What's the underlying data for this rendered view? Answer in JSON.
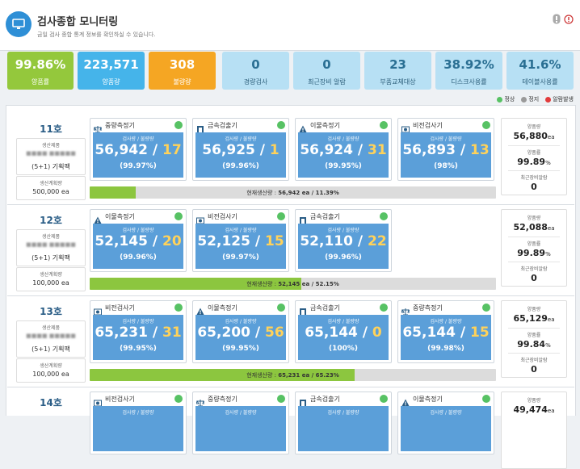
{
  "header": {
    "title": "검사종합 모니터링",
    "subtitle": "금일 검사 종합 통계 정보를 확인하실 수 있습니다."
  },
  "kpis": [
    {
      "value": "99.86%",
      "label": "양품률",
      "style": "green"
    },
    {
      "value": "223,571",
      "label": "양품량",
      "style": "blue"
    },
    {
      "value": "308",
      "label": "불량량",
      "style": "orange"
    },
    {
      "value": "0",
      "label": "경량검사",
      "style": "light"
    },
    {
      "value": "0",
      "label": "최근장비 알람",
      "style": "light"
    },
    {
      "value": "23",
      "label": "부품교체대상",
      "style": "light"
    },
    {
      "value": "38.92%",
      "label": "디스크사용률",
      "style": "light"
    },
    {
      "value": "41.6%",
      "label": "테이블사용률",
      "style": "light"
    }
  ],
  "legend": {
    "normal": "정상",
    "stop": "정지",
    "alarm": "알람발생",
    "colors": {
      "normal": "#57c264",
      "stop": "#9a9a9a",
      "alarm": "#e23b3b"
    }
  },
  "labels": {
    "product": "생산제품",
    "plan": "생산계획량",
    "capacity": "검사량 / 불량량",
    "current": "현재생산량 :",
    "good_qty": "양품량",
    "good_rate": "양품률",
    "recent_alarm": "최근장비알람",
    "unit_ea": "ea"
  },
  "lines": [
    {
      "name": "11호",
      "product_name": "■■■■ ■■■■■",
      "product_spec": "(5+1) 기획팩",
      "plan": "500,000 ea",
      "devices": [
        {
          "type": "scale",
          "name": "중량측정기",
          "total": "56,942",
          "ng": "17",
          "rate": "(99.97%)"
        },
        {
          "type": "metal",
          "name": "금속검출기",
          "total": "56,925",
          "ng": "1",
          "rate": "(99.96%)"
        },
        {
          "type": "warn",
          "name": "이물측정기",
          "total": "56,924",
          "ng": "31",
          "rate": "(99.95%)"
        },
        {
          "type": "vision",
          "name": "비전검사기",
          "total": "56,893",
          "ng": "13",
          "rate": "(98%)"
        }
      ],
      "progress_value": "56,942 ea / 11.39%",
      "progress_fraction": 0.1139,
      "good_qty": "56,880",
      "good_rate": "99.89",
      "alarm": "0"
    },
    {
      "name": "12호",
      "product_name": "■■■■ ■■■■■",
      "product_spec": "(5+1) 기획팩",
      "plan": "100,000 ea",
      "devices": [
        {
          "type": "warn",
          "name": "이물측정기",
          "total": "52,145",
          "ng": "20",
          "rate": "(99.96%)"
        },
        {
          "type": "vision",
          "name": "비전검사기",
          "total": "52,125",
          "ng": "15",
          "rate": "(99.97%)"
        },
        {
          "type": "metal",
          "name": "금속검출기",
          "total": "52,110",
          "ng": "22",
          "rate": "(99.96%)"
        }
      ],
      "progress_value": "52,145 ea / 52.15%",
      "progress_fraction": 0.5215,
      "good_qty": "52,088",
      "good_rate": "99.89",
      "alarm": "0"
    },
    {
      "name": "13호",
      "product_name": "■■■■ ■■■■■",
      "product_spec": "(5+1) 기획팩",
      "plan": "100,000 ea",
      "devices": [
        {
          "type": "vision",
          "name": "비전검사기",
          "total": "65,231",
          "ng": "31",
          "rate": "(99.95%)"
        },
        {
          "type": "warn",
          "name": "이물측정기",
          "total": "65,200",
          "ng": "56",
          "rate": "(99.95%)"
        },
        {
          "type": "metal",
          "name": "금속검출기",
          "total": "65,144",
          "ng": "0",
          "rate": "(100%)"
        },
        {
          "type": "scale",
          "name": "중량측정기",
          "total": "65,144",
          "ng": "15",
          "rate": "(99.98%)"
        }
      ],
      "progress_value": "65,231 ea / 65.23%",
      "progress_fraction": 0.6523,
      "good_qty": "65,129",
      "good_rate": "99.84",
      "alarm": "0"
    },
    {
      "name": "14호",
      "devices": [
        {
          "type": "vision",
          "name": "비전검사기"
        },
        {
          "type": "scale",
          "name": "중량측정기"
        },
        {
          "type": "metal",
          "name": "금속검출기"
        },
        {
          "type": "warn",
          "name": "이물측정기"
        }
      ],
      "good_qty": "49,474"
    }
  ]
}
